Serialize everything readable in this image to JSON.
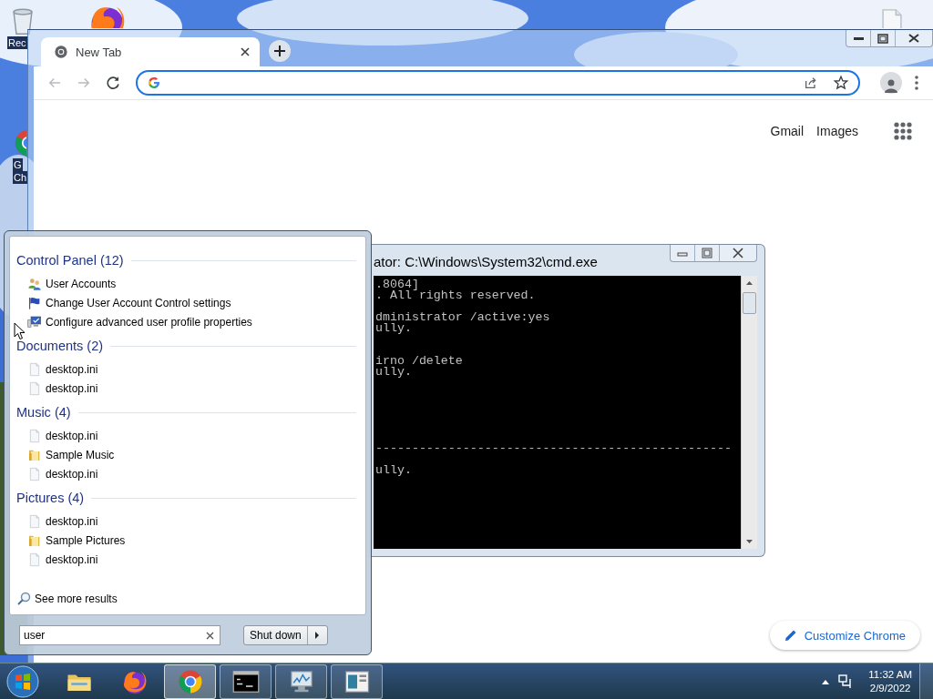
{
  "desktop": {
    "icons": [
      {
        "kind": "recycle-bin",
        "lines": [
          "Rec"
        ]
      },
      {
        "kind": "firefox"
      },
      {
        "kind": "chrome",
        "lines": [
          "G",
          "Ch"
        ]
      },
      {
        "kind": "file"
      }
    ]
  },
  "browser": {
    "tabs": [
      {
        "title": "New Tab",
        "selected": true
      }
    ],
    "links": [
      "Gmail",
      "Images"
    ],
    "customize_button": "Customize Chrome"
  },
  "console": {
    "title": "ator: C:\\Windows\\System32\\cmd.exe",
    "blocks": [
      [
        ".8064]",
        ". All rights reserved."
      ],
      [
        "dministrator /active:yes",
        "ully."
      ],
      [
        "irno /delete",
        "ully."
      ],
      [
        "-------------------------------------------------"
      ],
      [
        "ully."
      ]
    ]
  },
  "start_menu": {
    "groups": [
      {
        "title": "Control Panel (12)",
        "items": [
          {
            "kind": "users",
            "label": "User Accounts"
          },
          {
            "kind": "flag",
            "label": "Change User Account Control settings"
          },
          {
            "kind": "monitor",
            "label": "Configure advanced user profile properties"
          }
        ]
      },
      {
        "title": "Documents (2)",
        "items": [
          {
            "kind": "file",
            "label": "desktop.ini"
          },
          {
            "kind": "file",
            "label": "desktop.ini"
          }
        ]
      },
      {
        "title": "Music (4)",
        "items": [
          {
            "kind": "file",
            "label": "desktop.ini"
          },
          {
            "kind": "folder",
            "label": "Sample Music"
          },
          {
            "kind": "file",
            "label": "desktop.ini"
          }
        ]
      },
      {
        "title": "Pictures (4)",
        "items": [
          {
            "kind": "file",
            "label": "desktop.ini"
          },
          {
            "kind": "folder",
            "label": "Sample Pictures"
          },
          {
            "kind": "file",
            "label": "desktop.ini"
          }
        ]
      }
    ],
    "more_results": "See more results",
    "search": {
      "value": "user"
    },
    "shutdown": "Shut down"
  },
  "taskbar": {
    "apps": [
      {
        "kind": "explorer",
        "running": false,
        "selected": false
      },
      {
        "kind": "firefox",
        "running": false,
        "selected": false
      },
      {
        "kind": "chrome",
        "running": true,
        "selected": true
      },
      {
        "kind": "cmd",
        "running": true,
        "selected": false
      },
      {
        "kind": "perfmon",
        "running": true,
        "selected": false
      },
      {
        "kind": "reader",
        "running": true,
        "selected": false
      }
    ],
    "clock": {
      "time": "11:32 AM",
      "date": "2/9/2022"
    }
  }
}
